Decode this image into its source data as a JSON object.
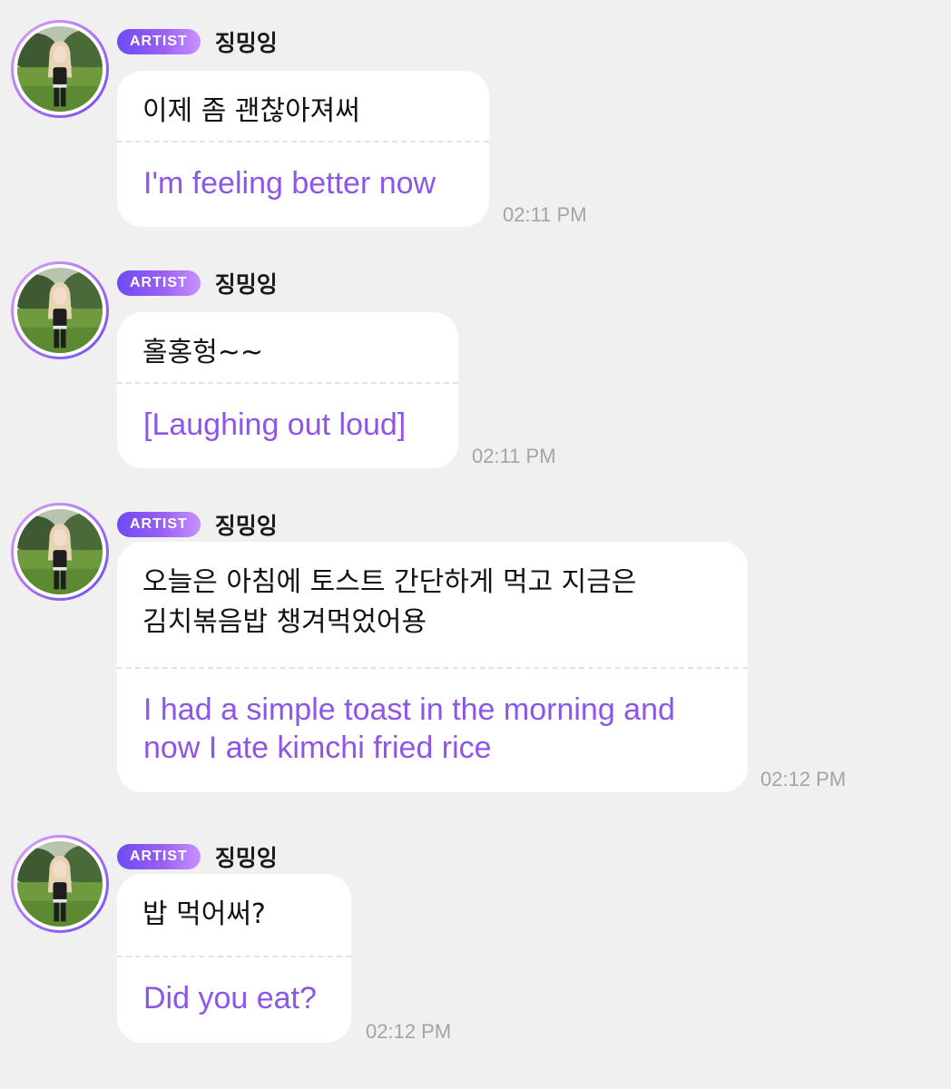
{
  "colors": {
    "background": "#f0f0f0",
    "bubble": "#ffffff",
    "translation_text": "#8e56e8",
    "badge_gradient": [
      "#6d4af5",
      "#c792ff"
    ],
    "timestamp": "#a4a4a4"
  },
  "messages": [
    {
      "badge": "ARTIST",
      "sender": "징밍잉",
      "original": "이제 좀 괜찮아져써",
      "translation": "I'm feeling better now",
      "time": "02:11 PM",
      "avatar_icon": "profile-photo"
    },
    {
      "badge": "ARTIST",
      "sender": "징밍잉",
      "original": "홀홍헝~~",
      "translation": "[Laughing out loud]",
      "time": "02:11 PM",
      "avatar_icon": "profile-photo"
    },
    {
      "badge": "ARTIST",
      "sender": "징밍잉",
      "original_lines": [
        "오늘은 아침에 토스트 간단하게 먹고 지금은",
        "김치볶음밥 챙겨먹었어용"
      ],
      "translation_lines": [
        "I had a simple toast in the morning and",
        "now I ate kimchi fried rice"
      ],
      "time": "02:12 PM",
      "avatar_icon": "profile-photo"
    },
    {
      "badge": "ARTIST",
      "sender": "징밍잉",
      "original": "밥 먹어써?",
      "translation": "Did you eat?",
      "time": "02:12 PM",
      "avatar_icon": "profile-photo"
    }
  ]
}
